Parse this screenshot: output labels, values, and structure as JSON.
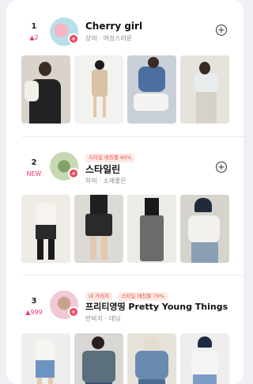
{
  "shops": [
    {
      "rank": "1",
      "change": "▲2",
      "name": "Cherry girl",
      "tags": "상의 · 여성스러운",
      "pills": []
    },
    {
      "rank": "2",
      "change": "NEW",
      "name": "스타일린",
      "tags": "하의 · 소재좋은",
      "pills": [
        "스타일 매칭률 80%"
      ]
    },
    {
      "rank": "3",
      "change": "▲999",
      "name": "프리티영띵 Pretty Young Things",
      "tags": "반바지 · 데님",
      "pills": [
        "내 거래처",
        "스타일 매칭률 79%"
      ]
    }
  ],
  "icons": {
    "favorite": "plus-circle-icon",
    "badge": "plus-badge-icon"
  },
  "colors": {
    "accent": "#f0465f",
    "rank_up": "#f03a5f",
    "pill_bg": "#fde9e7",
    "pill_text": "#e8584a"
  }
}
